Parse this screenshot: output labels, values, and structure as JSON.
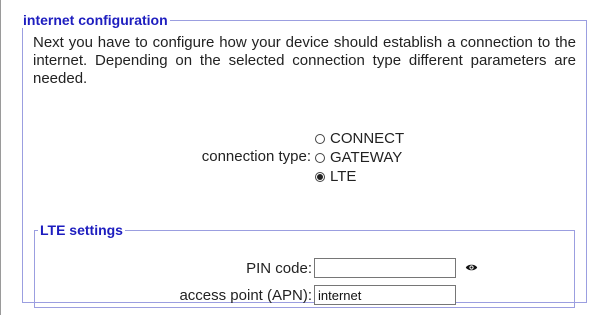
{
  "internet_config": {
    "legend": "internet configuration",
    "intro": "Next you have to configure how your device should establish a connection to the internet. Depending on the selected connection type different parameters are needed.",
    "connection_type": {
      "label": "connection type:",
      "options": [
        {
          "label": "CONNECT",
          "selected": false
        },
        {
          "label": "GATEWAY",
          "selected": false
        },
        {
          "label": "LTE",
          "selected": true
        }
      ]
    }
  },
  "lte_settings": {
    "legend": "LTE settings",
    "pin": {
      "label": "PIN code:",
      "value": ""
    },
    "apn": {
      "label": "access point (APN):",
      "value": "internet"
    }
  },
  "colors": {
    "legend": "#1d1dbf",
    "fieldset_border": "#9b9ee0"
  },
  "icons": {
    "show_pin": "eye-icon"
  }
}
